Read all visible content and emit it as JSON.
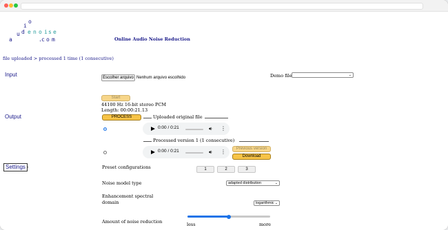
{
  "logo": {
    "letters": [
      "a",
      "u",
      "d",
      "i",
      "o",
      "e",
      "n",
      "o",
      "i",
      "s",
      "e",
      ".",
      "c",
      "o",
      "m"
    ]
  },
  "header": {
    "title": "Online Audio Noise Reduction"
  },
  "status": {
    "text": "file uploaded > processed 1 time (1 consecutive)"
  },
  "input": {
    "label": "Input",
    "choose_file_label": "Escolher arquivo",
    "no_file_text": "Nenhum arquivo escolhido",
    "demo_files_label": "Demo files",
    "demo_files_value": "",
    "start_label": "Start",
    "file_info_format": "44100 Hz 16-bit stereo PCM",
    "file_info_length": "Length: 00:00:21.13"
  },
  "output": {
    "label": "Output",
    "process_label": "PROCESS",
    "original_legend": "Uploaded original file",
    "processed_legend": "Processed version 1 (1 consecutive)",
    "original_audio_time": "0:00 / 0:21",
    "processed_audio_time": "0:00 / 0:21",
    "previous_version_label": "Previous version",
    "download_label": "Download"
  },
  "settings": {
    "label": "Settings",
    "toggle_symbol": "-",
    "preset_label": "Preset configurations",
    "presets": [
      "1",
      "2",
      "3"
    ],
    "noise_model_label": "Noise model type",
    "noise_model_value": "adapted distribution",
    "domain_label_line1": "Enhancement spectral",
    "domain_label_line2": "domain",
    "domain_value": "logarithmic",
    "amount_label": "Amount of noise reduction",
    "amount_min_label": "less",
    "amount_max_label": "more",
    "amount_fraction": 0.5
  },
  "colors": {
    "accent": "#1a1a8a",
    "button_yellow": "#f7c346",
    "slider_blue": "#1a73e8"
  }
}
